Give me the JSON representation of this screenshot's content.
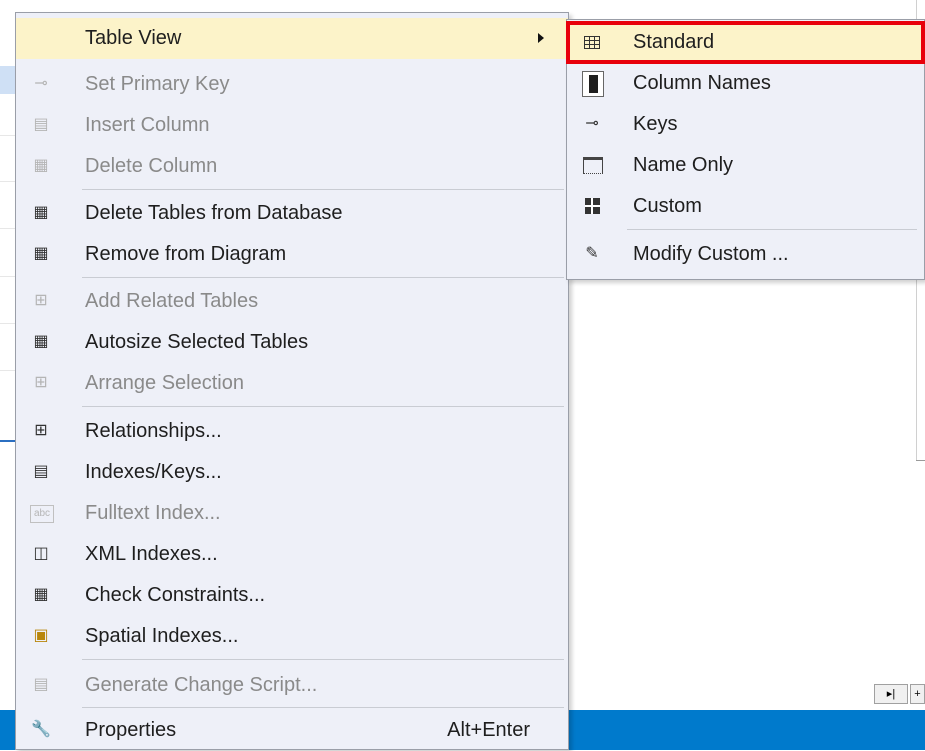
{
  "context_menu": {
    "items": [
      {
        "label": "Table View",
        "icon": "table-view-icon",
        "enabled": true,
        "submenu": true
      },
      {
        "label": "Set Primary Key",
        "icon": "key-icon",
        "enabled": false
      },
      {
        "label": "Insert Column",
        "icon": "insert-column-icon",
        "enabled": false
      },
      {
        "label": "Delete Column",
        "icon": "delete-column-icon",
        "enabled": false
      },
      {
        "label": "Delete Tables from Database",
        "icon": "delete-table-icon",
        "enabled": true
      },
      {
        "label": "Remove from Diagram",
        "icon": "remove-table-icon",
        "enabled": true
      },
      {
        "label": "Add Related Tables",
        "icon": "add-related-icon",
        "enabled": false
      },
      {
        "label": "Autosize Selected Tables",
        "icon": "autosize-icon",
        "enabled": true
      },
      {
        "label": "Arrange Selection",
        "icon": "arrange-icon",
        "enabled": false
      },
      {
        "label": "Relationships...",
        "icon": "relationships-icon",
        "enabled": true
      },
      {
        "label": "Indexes/Keys...",
        "icon": "indexes-keys-icon",
        "enabled": true
      },
      {
        "label": "Fulltext Index...",
        "icon": "fulltext-index-icon",
        "enabled": false
      },
      {
        "label": "XML Indexes...",
        "icon": "xml-index-icon",
        "enabled": true
      },
      {
        "label": "Check Constraints...",
        "icon": "check-constraints-icon",
        "enabled": true
      },
      {
        "label": "Spatial Indexes...",
        "icon": "spatial-index-icon",
        "enabled": true
      },
      {
        "label": "Generate Change Script...",
        "icon": "generate-script-icon",
        "enabled": false
      },
      {
        "label": "Properties",
        "icon": "wrench-icon",
        "enabled": true,
        "shortcut": "Alt+Enter"
      }
    ]
  },
  "table_view_submenu": {
    "items": [
      {
        "label": "Standard",
        "icon": "standard-view-icon",
        "highlighted": true
      },
      {
        "label": "Column Names",
        "icon": "column-names-icon"
      },
      {
        "label": "Keys",
        "icon": "keys-icon"
      },
      {
        "label": "Name Only",
        "icon": "name-only-icon"
      },
      {
        "label": "Custom",
        "icon": "custom-view-icon"
      },
      {
        "label": "Modify Custom ...",
        "icon": "pencil-icon"
      }
    ]
  },
  "icons": {
    "key": "⊸",
    "insert_column": "▤",
    "delete_column": "▦",
    "delete_table": "▦",
    "remove_table": "▦",
    "add_related": "⊞",
    "autosize": "▦",
    "arrange": "⊞",
    "relationships": "⊞",
    "indexes_keys": "▤",
    "fulltext": "abc",
    "xml_index": "◫",
    "check_constraints": "▦",
    "spatial_index": "▣",
    "generate_script": "▤",
    "wrench": "🔧",
    "keys": "⊸",
    "pencil": "✎"
  },
  "colors": {
    "menu_background": "#eef0f8",
    "highlight": "#fcf3c9",
    "annotation_box": "#e8000b",
    "status_bar": "#007acc"
  }
}
